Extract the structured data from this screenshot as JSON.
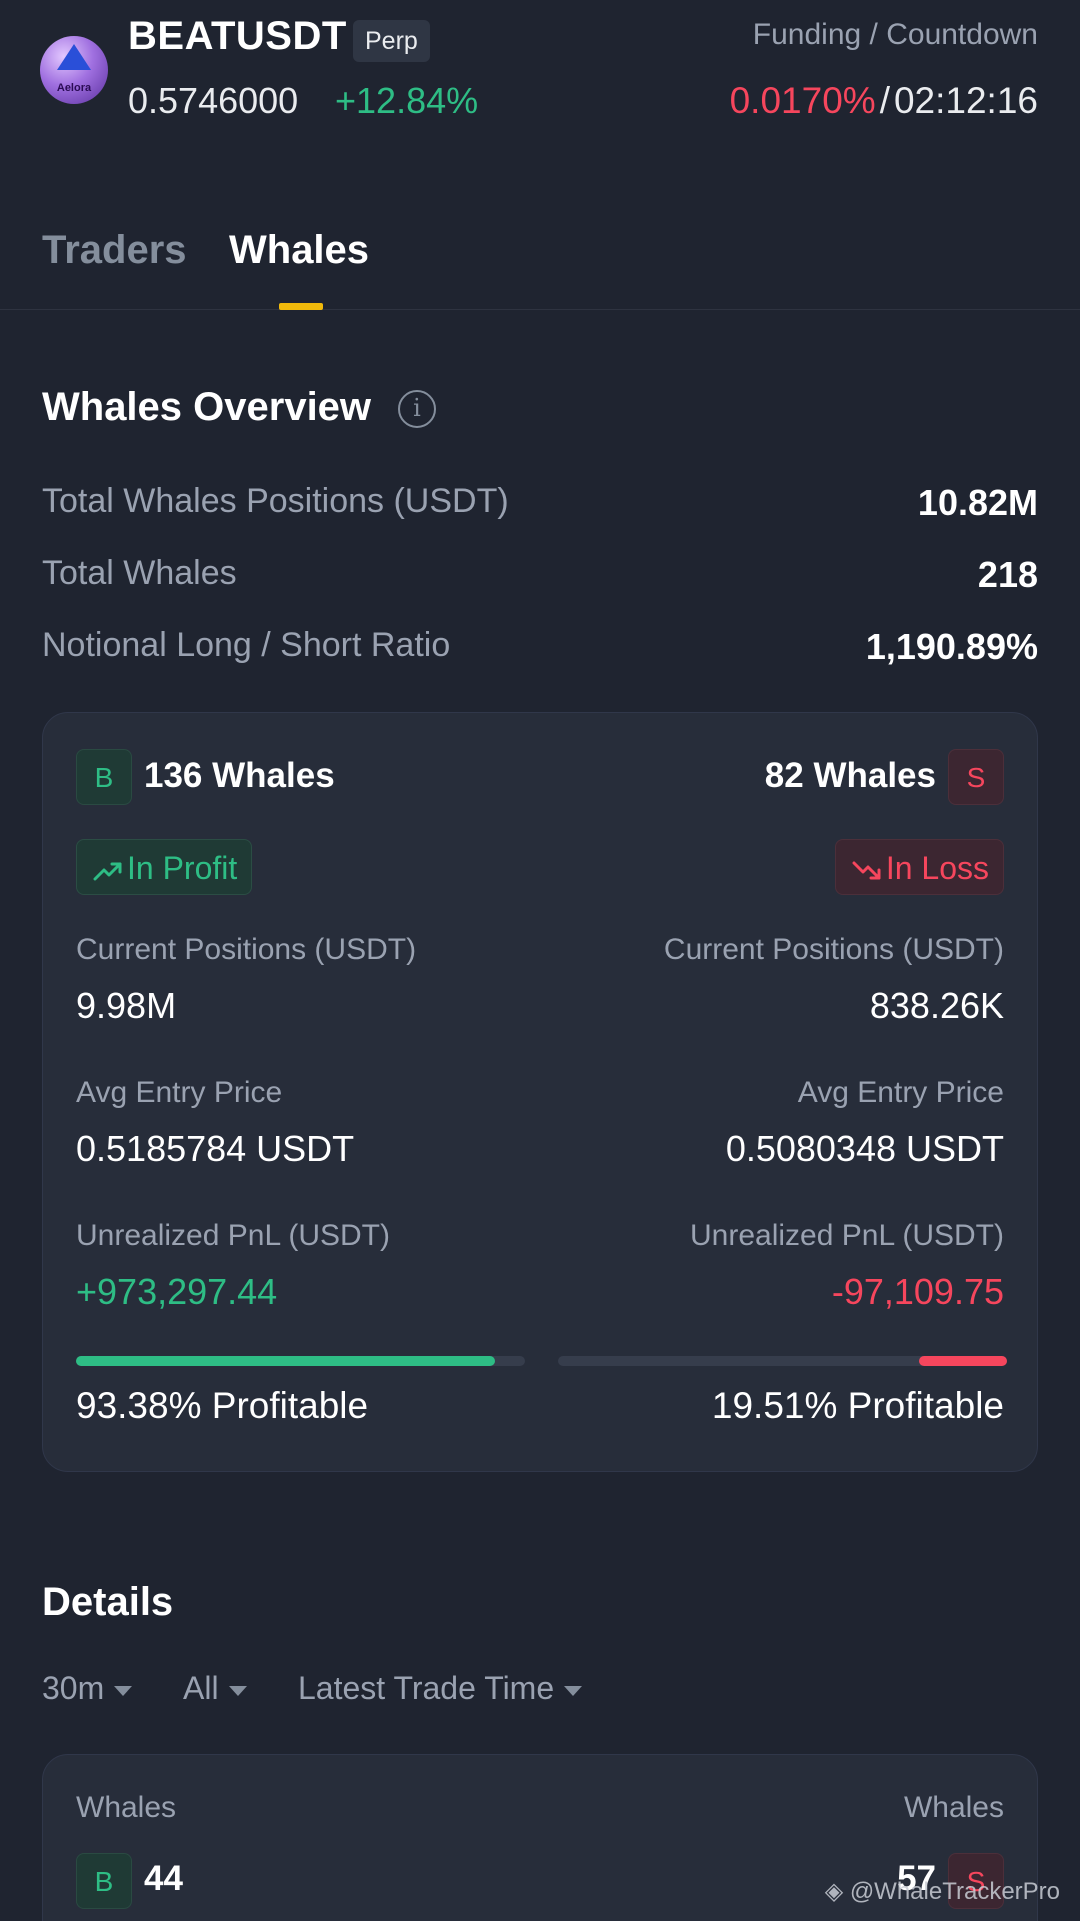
{
  "header": {
    "avatar_text": "Aelora",
    "symbol": "BEATUSDT",
    "contract_tag": "Perp",
    "last_price": "0.5746000",
    "change_pct": "+12.84%",
    "funding_label": "Funding / Countdown",
    "funding_rate": "0.0170%",
    "separator": "/",
    "countdown": "02:12:16"
  },
  "tabs": [
    {
      "label": "Traders",
      "active": false
    },
    {
      "label": "Whales",
      "active": true
    }
  ],
  "overview": {
    "title": "Whales Overview",
    "info_glyph": "i",
    "stats": [
      {
        "label": "Total Whales Positions (USDT)",
        "value": "10.82M"
      },
      {
        "label": "Total Whales",
        "value": "218"
      },
      {
        "label": "Notional Long / Short Ratio",
        "value": "1,190.89%"
      }
    ]
  },
  "long_side": {
    "badge": "B",
    "whales": "136 Whales",
    "status": "In Profit",
    "positions_label": "Current Positions (USDT)",
    "positions_value": "9.98M",
    "entry_label": "Avg Entry Price",
    "entry_value": "0.5185784 USDT",
    "pnl_label": "Unrealized PnL (USDT)",
    "pnl_value": "+973,297.44",
    "profitable_pct": 93.38,
    "profitable_text": "93.38% Profitable"
  },
  "short_side": {
    "badge": "S",
    "whales": "82 Whales",
    "status": "In Loss",
    "positions_label": "Current Positions (USDT)",
    "positions_value": "838.26K",
    "entry_label": "Avg Entry Price",
    "entry_value": "0.5080348 USDT",
    "pnl_label": "Unrealized PnL (USDT)",
    "pnl_value": "-97,109.75",
    "profitable_pct": 19.51,
    "profitable_text": "19.51% Profitable"
  },
  "details": {
    "title": "Details",
    "filters": [
      "30m",
      "All",
      "Latest Trade Time"
    ],
    "card": {
      "left_label": "Whales",
      "left_badge": "B",
      "left_value": "44",
      "right_label": "Whales",
      "right_badge": "S",
      "right_value": "57"
    }
  },
  "watermark": "@WhaleTrackerPro",
  "colors": {
    "background": "#1f2430",
    "card": "#272d3a",
    "positive": "#2ebd85",
    "negative": "#f6465d",
    "accent": "#f0b90b",
    "muted_text": "#9aa2b1"
  }
}
